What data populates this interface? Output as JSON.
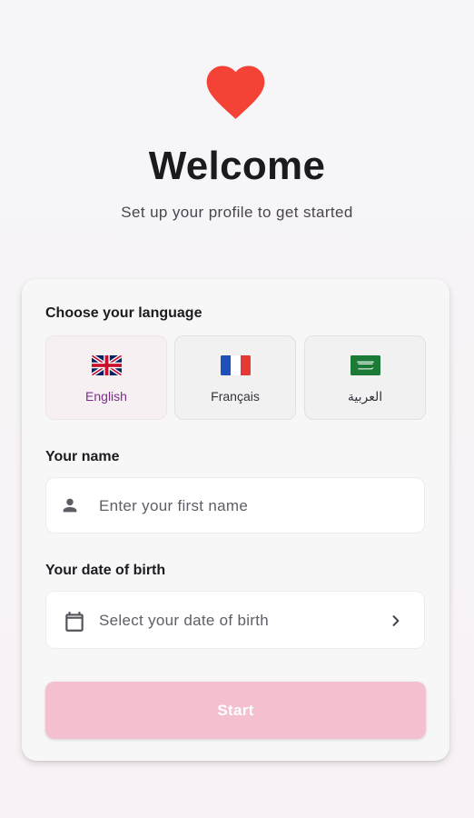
{
  "header": {
    "title": "Welcome",
    "subtitle": "Set up your profile to get started",
    "heart_color": "#f44336"
  },
  "language": {
    "label": "Choose your language",
    "options": [
      {
        "label": "English",
        "flag": "uk-flag-icon",
        "selected": true
      },
      {
        "label": "Français",
        "flag": "france-flag-icon",
        "selected": false
      },
      {
        "label": "العربية",
        "flag": "saudi-flag-icon",
        "selected": false
      }
    ]
  },
  "name": {
    "label": "Your name",
    "placeholder": "Enter your first name",
    "icon": "person-icon"
  },
  "dob": {
    "label": "Your date of birth",
    "placeholder": "Select your date of birth",
    "icon": "calendar-icon",
    "trailing_icon": "chevron-right-icon"
  },
  "start_button": {
    "label": "Start",
    "color": "#f4bfcf"
  }
}
